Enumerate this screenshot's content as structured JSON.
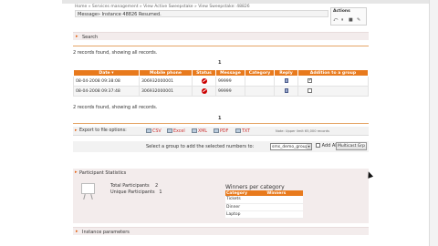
{
  "breadcrumb": {
    "home": "Home",
    "services": "Services management",
    "sweeps": "View Active Sweepstake",
    "current": "View Sweepstake: 48826"
  },
  "message": "Message» Instance 48826 Resumed.",
  "actions": {
    "title": "Actions"
  },
  "search": {
    "label": "Search"
  },
  "results": {
    "summary": "2 records found, showing all records.",
    "page": "1",
    "columns": [
      "Date",
      "Mobile phone",
      "Status",
      "Message",
      "Category",
      "Reply",
      "Addition to a group"
    ],
    "rows": [
      {
        "date": "08-04-2008 09:38:08",
        "phone": "306932000001",
        "message": "99999",
        "category": "",
        "added": true
      },
      {
        "date": "08-04-2008 09:37:48",
        "phone": "306932000001",
        "message": "99999",
        "category": "",
        "added": false
      }
    ]
  },
  "export": {
    "label": "Export to file options:",
    "csv": "CSV",
    "excel": "Excel",
    "xml": "XML",
    "pdf": "PDF",
    "txt": "TXT",
    "note": "Note: Upper limit 65,000 records"
  },
  "group": {
    "label": "Select a group to add the selected numbers to:",
    "selected": "sms_demo_group",
    "add_all": "Add All",
    "button": "Multicast Grp"
  },
  "participants": {
    "title": "Participant Statistics",
    "total_label": "Total Participants",
    "total_value": "2",
    "unique_label": "Unique Participants",
    "unique_value": "1",
    "winners_title": "Winners per category",
    "winners_cols": [
      "Category",
      "Winners"
    ],
    "winners_rows": [
      {
        "category": "Tickets",
        "winners": ""
      },
      {
        "category": "Dinner",
        "winners": ""
      },
      {
        "category": "Laptop",
        "winners": ""
      }
    ]
  },
  "instance": {
    "label": "Instance parameters"
  },
  "colors": {
    "accent": "#e87a1d",
    "section_bg": "#f3ecec",
    "deny": "#cc0000"
  }
}
